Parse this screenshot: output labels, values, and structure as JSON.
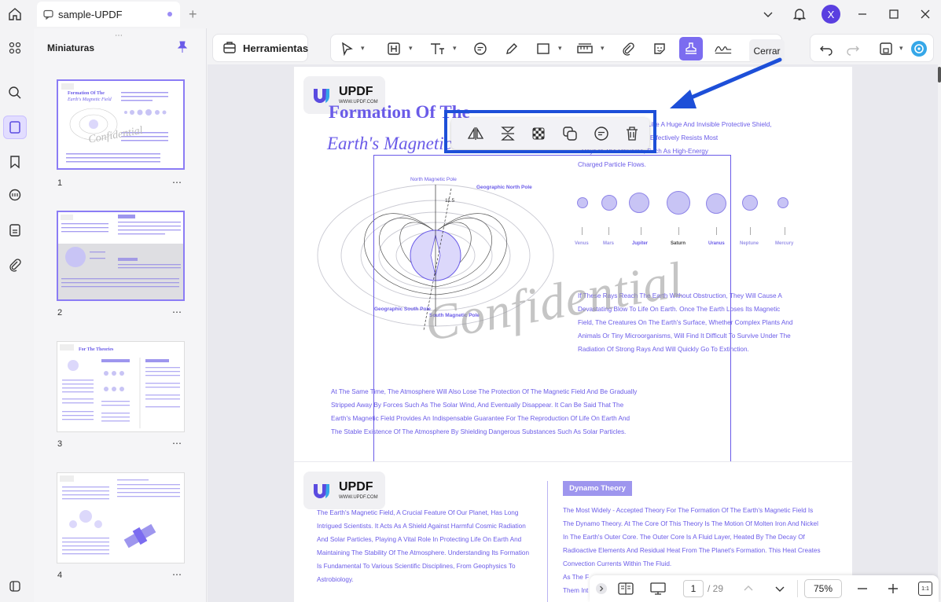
{
  "window": {
    "tab_title": "sample-UPDF",
    "avatar_letter": "X"
  },
  "sidebar": {
    "title": "Miniaturas",
    "thumbnails": [
      {
        "number": "1",
        "heading_line1": "Formation Of The",
        "heading_line2": "Earth's Magnetic Field"
      },
      {
        "number": "2"
      },
      {
        "number": "3",
        "heading": "For The Theories"
      },
      {
        "number": "4"
      }
    ]
  },
  "toolbar": {
    "tools_label": "Herramientas",
    "close_label": "Cerrar"
  },
  "floating_toolbar": {
    "items": [
      "flip-horizontal-icon",
      "flip-vertical-icon",
      "opacity-icon",
      "copy-icon",
      "comment-icon",
      "delete-icon"
    ]
  },
  "document": {
    "logo_text": "UPDF",
    "logo_url": "WWW.UPDF.COM",
    "page1": {
      "title_line1": "Formation Of The",
      "title_line2": "Earth's Magnetic",
      "intro_lines": [
        "Is Like A Huge And Invisible Protective Shield,",
        "Cosmic Environment. It Effectively Resists Most",
        "Rays In The Universe, Such As High-Energy",
        "Charged Particle Flows."
      ],
      "diagram_labels": {
        "north_magnetic": "North Magnetic Pole",
        "geo_north": "Geographic North Pole",
        "angle": "11.5",
        "geo_south": "Geographic South Pole",
        "south_magnetic": "South Magnetic Pole"
      },
      "planets": [
        "Venus",
        "Mars",
        "Jupiter",
        "Saturn",
        "Uranus",
        "Neptune",
        "Mercury"
      ],
      "right_paragraph": [
        "If These Rays Reach The Earth Without Obstruction, They Will Cause A",
        "Devastating Blow To Life On Earth. Once The Earth Loses Its Magnetic",
        "Field, The Creatures On The Earth's Surface, Whether Complex Plants And",
        "Animals Or Tiny Microorganisms, Will Find It Difficult To Survive Under The",
        "Radiation Of Strong Rays And Will Quickly Go To Extinction."
      ],
      "bottom_paragraph": [
        "At The Same Time, The Atmosphere Will Also Lose The Protection Of The Magnetic Field And Be Gradually",
        "Stripped Away By Forces Such As The Solar Wind, And Eventually Disappear. It Can Be Said That The",
        "Earth's Magnetic Field Provides An Indispensable Guarantee For The Reproduction Of Life On Earth And",
        "The Stable Existence Of The Atmosphere By Shielding Dangerous Substances Such As Solar Particles."
      ],
      "watermark": "Confidential"
    },
    "page2": {
      "left_paragraph": [
        "The Earth's Magnetic Field, A Crucial Feature Of Our Planet, Has Long",
        "Intrigued Scientists. It Acts As A Shield Against Harmful Cosmic Radiation",
        "And Solar Particles, Playing A Vital Role In Protecting Life On Earth And",
        "Maintaining The Stability Of The Atmosphere. Understanding Its Formation",
        "Is Fundamental To Various Scientific Disciplines, From Geophysics To",
        "Astrobiology."
      ],
      "badge": "Dynamo Theory",
      "right_paragraph": [
        "The Most Widely - Accepted Theory For The Formation Of The Earth's Magnetic Field Is",
        "The Dynamo Theory. At The Core Of This Theory Is The Motion Of Molten Iron And Nickel",
        "In The Earth's Outer Core. The Outer Core Is A Fluid Layer, Heated By The Decay Of",
        "Radioactive Elements And Residual Heat From The Planet's Formation. This Heat Creates",
        "Convection Currents Within The Fluid.",
        "As The F",
        "Them Int"
      ]
    }
  },
  "bottom_bar": {
    "current_page": "1",
    "total_pages": "/ 29",
    "zoom": "75%",
    "fit_label": "1:1"
  },
  "colors": {
    "accent": "#6a5be8",
    "highlight": "#1d4fd8"
  }
}
